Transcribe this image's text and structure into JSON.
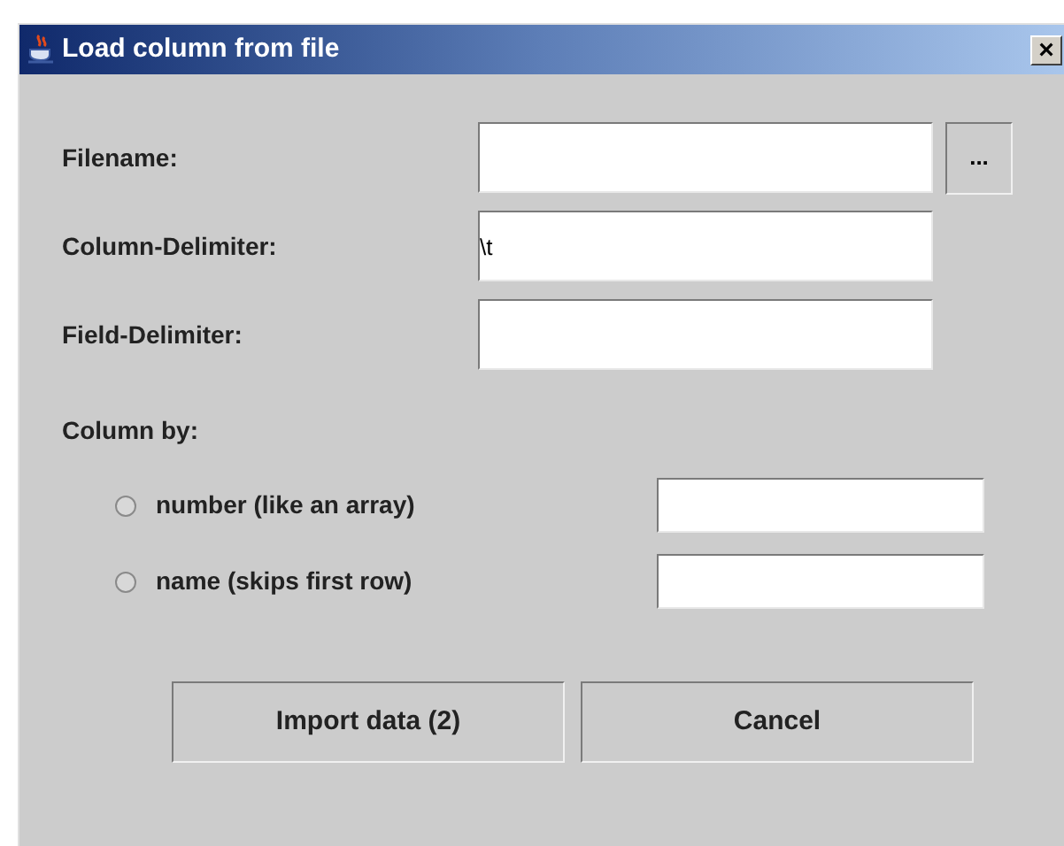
{
  "window": {
    "title": "Load column from file",
    "close": "×"
  },
  "fields": [
    {
      "label": "Filename:",
      "browse": "..."
    },
    {
      "label": "Column-Delimiter:",
      "value": "\\t"
    },
    {
      "label": "Field-Delimiter:"
    }
  ],
  "column_by": {
    "label": "Column by:",
    "options": [
      {
        "label": "number (like an array)",
        "selected": false
      },
      {
        "label": "name (skips first row)",
        "selected": false
      }
    ]
  },
  "buttons": [
    "Import data (2)",
    "Cancel"
  ]
}
